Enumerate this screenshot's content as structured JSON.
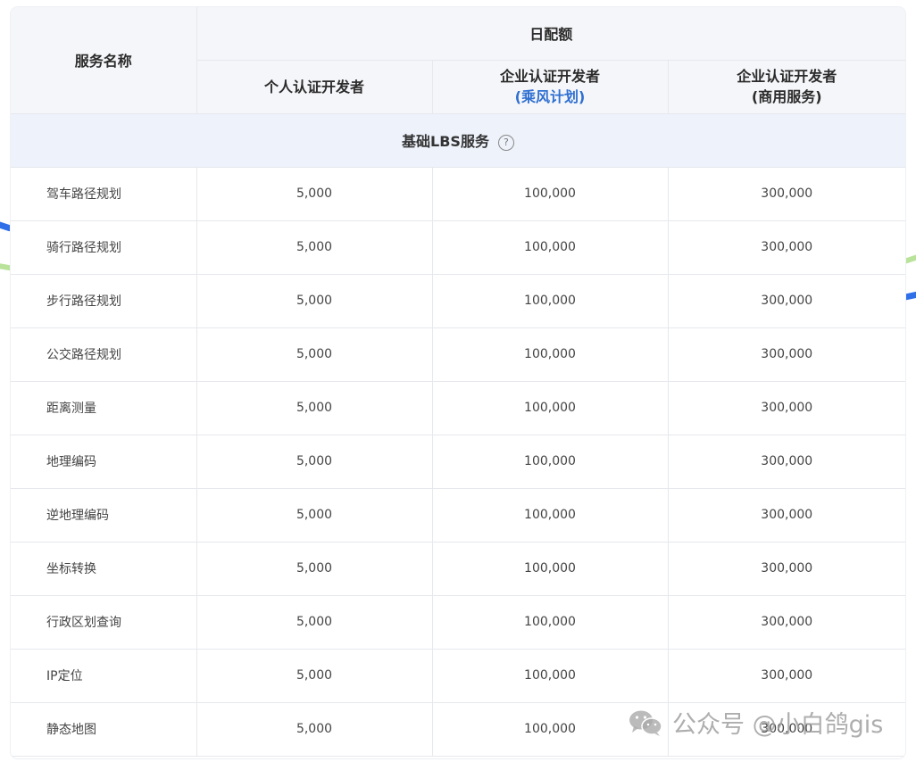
{
  "header": {
    "service_name": "服务名称",
    "daily_quota": "日配额",
    "col_personal": "个人认证开发者",
    "col_enterprise_plan_line1": "企业认证开发者",
    "col_enterprise_plan_line2": "(乘风计划)",
    "col_enterprise_commercial_line1": "企业认证开发者",
    "col_enterprise_commercial_line2": "(商用服务)"
  },
  "section": {
    "title": "基础LBS服务",
    "help_icon": "question-circle-icon"
  },
  "rows": [
    {
      "name": "驾车路径规划",
      "personal": "5,000",
      "enterprise_plan": "100,000",
      "enterprise_commercial": "300,000"
    },
    {
      "name": "骑行路径规划",
      "personal": "5,000",
      "enterprise_plan": "100,000",
      "enterprise_commercial": "300,000"
    },
    {
      "name": "步行路径规划",
      "personal": "5,000",
      "enterprise_plan": "100,000",
      "enterprise_commercial": "300,000"
    },
    {
      "name": "公交路径规划",
      "personal": "5,000",
      "enterprise_plan": "100,000",
      "enterprise_commercial": "300,000"
    },
    {
      "name": "距离测量",
      "personal": "5,000",
      "enterprise_plan": "100,000",
      "enterprise_commercial": "300,000"
    },
    {
      "name": "地理编码",
      "personal": "5,000",
      "enterprise_plan": "100,000",
      "enterprise_commercial": "300,000"
    },
    {
      "name": "逆地理编码",
      "personal": "5,000",
      "enterprise_plan": "100,000",
      "enterprise_commercial": "300,000"
    },
    {
      "name": "坐标转换",
      "personal": "5,000",
      "enterprise_plan": "100,000",
      "enterprise_commercial": "300,000"
    },
    {
      "name": "行政区划查询",
      "personal": "5,000",
      "enterprise_plan": "100,000",
      "enterprise_commercial": "300,000"
    },
    {
      "name": "IP定位",
      "personal": "5,000",
      "enterprise_plan": "100,000",
      "enterprise_commercial": "300,000"
    },
    {
      "name": "静态地图",
      "personal": "5,000",
      "enterprise_plan": "100,000",
      "enterprise_commercial": "300,000"
    }
  ],
  "watermark": {
    "text": "公众号 @小白鸽gis",
    "icon": "wechat-icon"
  },
  "colors": {
    "header_bg": "#f5f6f9",
    "section_bg": "#eef2fb",
    "accent_blue": "#2f6fd1",
    "border": "#e6e8ed"
  }
}
